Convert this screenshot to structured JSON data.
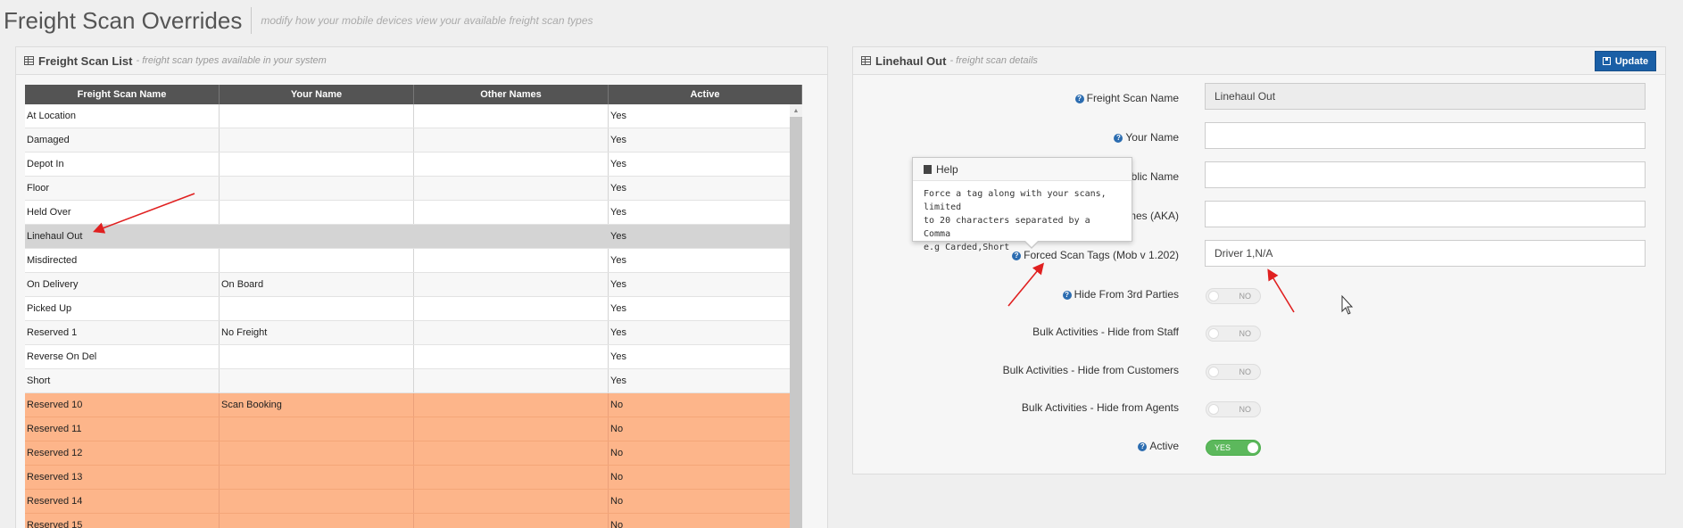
{
  "page": {
    "title": "Freight Scan Overrides",
    "subtitle": "modify how your mobile devices view your available freight scan types"
  },
  "scan_list": {
    "heading": "Freight Scan List",
    "subheading": "- freight scan types available in your system",
    "columns": [
      "Freight Scan Name",
      "Your Name",
      "Other Names",
      "Active"
    ],
    "rows": [
      {
        "name": "At Location",
        "your_name": "",
        "other_names": "",
        "active": "Yes"
      },
      {
        "name": "Damaged",
        "your_name": "",
        "other_names": "",
        "active": "Yes"
      },
      {
        "name": "Depot In",
        "your_name": "",
        "other_names": "",
        "active": "Yes"
      },
      {
        "name": "Floor",
        "your_name": "",
        "other_names": "",
        "active": "Yes"
      },
      {
        "name": "Held Over",
        "your_name": "",
        "other_names": "",
        "active": "Yes"
      },
      {
        "name": "Linehaul Out",
        "your_name": "",
        "other_names": "",
        "active": "Yes",
        "selected": true
      },
      {
        "name": "Misdirected",
        "your_name": "",
        "other_names": "",
        "active": "Yes"
      },
      {
        "name": "On Delivery",
        "your_name": "On Board",
        "other_names": "",
        "active": "Yes"
      },
      {
        "name": "Picked Up",
        "your_name": "",
        "other_names": "",
        "active": "Yes"
      },
      {
        "name": "Reserved 1",
        "your_name": "No Freight",
        "other_names": "",
        "active": "Yes"
      },
      {
        "name": "Reverse On Del",
        "your_name": "",
        "other_names": "",
        "active": "Yes"
      },
      {
        "name": "Short",
        "your_name": "",
        "other_names": "",
        "active": "Yes"
      },
      {
        "name": "Reserved 10",
        "your_name": "Scan Booking",
        "other_names": "",
        "active": "No"
      },
      {
        "name": "Reserved 11",
        "your_name": "",
        "other_names": "",
        "active": "No"
      },
      {
        "name": "Reserved 12",
        "your_name": "",
        "other_names": "",
        "active": "No"
      },
      {
        "name": "Reserved 13",
        "your_name": "",
        "other_names": "",
        "active": "No"
      },
      {
        "name": "Reserved 14",
        "your_name": "",
        "other_names": "",
        "active": "No"
      },
      {
        "name": "Reserved 15",
        "your_name": "",
        "other_names": "",
        "active": "No"
      }
    ],
    "inactive_color": "#fdb58a",
    "selected_color": "#d4d4d4"
  },
  "details": {
    "heading": "Linehaul Out",
    "subheading": "- freight scan details",
    "update_label": "Update",
    "fields": {
      "scan_name": {
        "label": "Freight Scan Name",
        "value": "Linehaul Out"
      },
      "your_name": {
        "label": "Your Name",
        "value": ""
      },
      "public_name": {
        "label_visible": "ublic Name",
        "value": ""
      },
      "aka": {
        "label_visible": "mes (AKA)",
        "value": ""
      },
      "forced_tags": {
        "label": "Forced Scan Tags (Mob v 1.202)",
        "value": "Driver 1,N/A"
      }
    },
    "toggles": {
      "hide_3rd": {
        "label": "Hide From 3rd Parties",
        "state": "NO"
      },
      "bulk_staff": {
        "label": "Bulk Activities - Hide from Staff",
        "state": "NO"
      },
      "bulk_customers": {
        "label": "Bulk Activities - Hide from Customers",
        "state": "NO"
      },
      "bulk_agents": {
        "label": "Bulk Activities - Hide from Agents",
        "state": "NO"
      },
      "active": {
        "label": "Active",
        "state": "YES"
      }
    },
    "accent_color": "#1a5fa6",
    "toggle_on_color": "#5cb85c"
  },
  "help_popover": {
    "title": "Help",
    "line1": "Force a tag along with your scans, limited",
    "line2": "to 20 characters separated by a Comma",
    "line3": "e.g Carded,Short"
  },
  "annotation_color": "#e02020"
}
